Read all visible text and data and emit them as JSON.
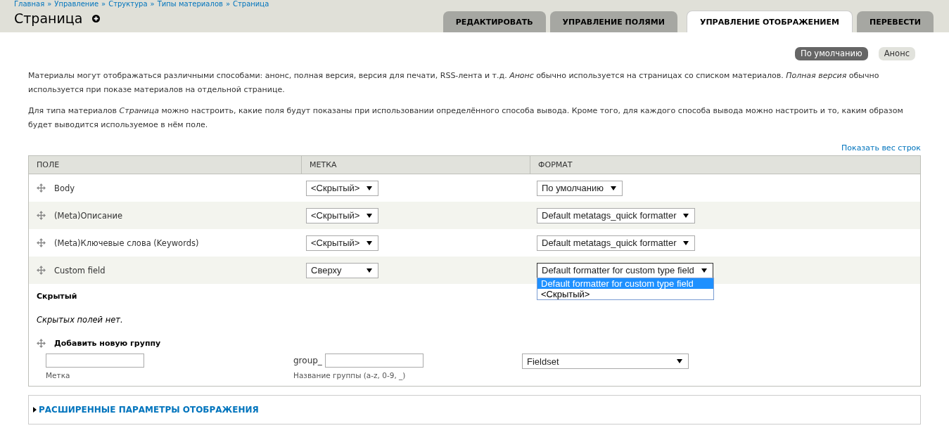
{
  "breadcrumb": {
    "items": [
      "Главная",
      "Управление",
      "Структура",
      "Типы материалов",
      "Страница"
    ],
    "separator": "»"
  },
  "title": "Страница",
  "tabs": [
    {
      "label": "РЕДАКТИРОВАТЬ",
      "selected": false
    },
    {
      "label": "УПРАВЛЕНИЕ ПОЛЯМИ",
      "selected": false
    },
    {
      "label": "УПРАВЛЕНИЕ ОТОБРАЖЕНИЕМ",
      "selected": true
    },
    {
      "label": "ПЕРЕВЕСТИ",
      "selected": false
    }
  ],
  "secondary_tabs": [
    {
      "label": "По умолчанию",
      "selected": true
    },
    {
      "label": "Анонс",
      "selected": false
    }
  ],
  "paragraphs": [
    "Материалы могут отображаться различными способами: анонс, полная версия, версия для печати, RSS-лента и т.д. *Анонс* обычно используется на страницах со списком материалов. *Полная версия* обычно используется при показе материалов на отдельной странице.",
    "Для типа материалов *Страница* можно настроить, какие поля будут показаны при использовании определённого способа вывода. Кроме того, для каждого способа вывода можно настроить и то, каким образом будет выводится используемое в нём поле."
  ],
  "show_weights_link": "Показать вес строк",
  "table": {
    "columns": [
      "ПОЛЕ",
      "МЕТКА",
      "ФОРМАТ"
    ],
    "rows": [
      {
        "field": "Body",
        "label": "<Скрытый>",
        "format": "По умолчанию"
      },
      {
        "field": "(Meta)Описание",
        "label": "<Скрытый>",
        "format": "Default metatags_quick formatter"
      },
      {
        "field": "(Meta)Ключевые слова (Keywords)",
        "label": "<Скрытый>",
        "format": "Default metatags_quick formatter"
      },
      {
        "field": "Custom field",
        "label": "Сверху",
        "format": "Default formatter for custom type field",
        "dropdown_options": [
          {
            "label": "Default formatter for custom type field",
            "selected": true
          },
          {
            "label": "<Скрытый>",
            "selected": false
          }
        ]
      }
    ],
    "hidden_region": {
      "title": "Скрытый",
      "empty_text": "Скрытых полей нет."
    },
    "add_group": {
      "title": "Добавить новую группу",
      "label_description": "Метка",
      "name_prefix": "group_",
      "name_description": "Название группы (a-z, 0-9, _)",
      "format": "Fieldset"
    }
  },
  "advanced_section": {
    "title": "РАСШИРЕННЫЕ ПАРАМЕТРЫ ОТОБРАЖЕНИЯ",
    "expanded": false
  }
}
